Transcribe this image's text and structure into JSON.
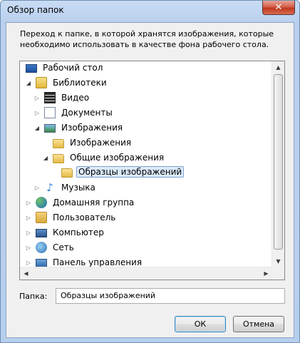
{
  "window": {
    "title": "Обзор папок",
    "close_symbol": "✕"
  },
  "instruction": "Переход к папке, в которой хранятся изображения, которые необходимо использовать в качестве фона рабочего стола.",
  "tree": {
    "items": [
      {
        "label": "Рабочий стол",
        "icon": "desktop-icon",
        "expander": "none"
      },
      {
        "label": "Библиотеки",
        "icon": "libraries-icon",
        "expander": "open"
      },
      {
        "label": "Видео",
        "icon": "video-library-icon",
        "expander": "closed"
      },
      {
        "label": "Документы",
        "icon": "documents-library-icon",
        "expander": "closed"
      },
      {
        "label": "Изображения",
        "icon": "pictures-library-icon",
        "expander": "open"
      },
      {
        "label": "Изображения",
        "icon": "folder-icon",
        "expander": "none"
      },
      {
        "label": "Общие изображения",
        "icon": "folder-icon",
        "expander": "open"
      },
      {
        "label": "Образцы изображений",
        "icon": "folder-open-icon",
        "expander": "none",
        "selected": true
      },
      {
        "label": "Музыка",
        "icon": "music-library-icon",
        "expander": "closed"
      },
      {
        "label": "Домашняя группа",
        "icon": "homegroup-icon",
        "expander": "closed"
      },
      {
        "label": "Пользователь",
        "icon": "user-folder-icon",
        "expander": "closed"
      },
      {
        "label": "Компьютер",
        "icon": "computer-icon",
        "expander": "closed"
      },
      {
        "label": "Сеть",
        "icon": "network-icon",
        "expander": "closed"
      },
      {
        "label": "Панель управления",
        "icon": "control-panel-icon",
        "expander": "closed"
      }
    ]
  },
  "folder": {
    "label": "Папка:",
    "value": "Образцы изображений"
  },
  "buttons": {
    "ok": "ОК",
    "cancel": "Отмена"
  },
  "colors": {
    "selection_bg": "#dcebfc",
    "selection_border": "#7da2ce",
    "frame": "#b9d0ee",
    "close_button": "#c0381e"
  }
}
